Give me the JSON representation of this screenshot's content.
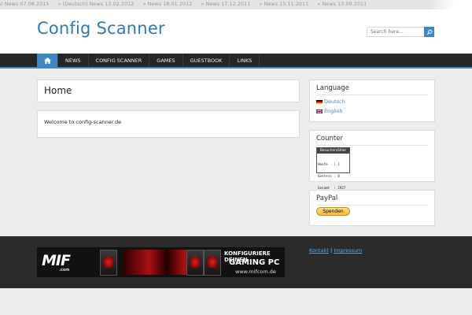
{
  "ticker": {
    "items": [
      "sch) News 07.08.2015",
      "» (Deutsch) News 13.02.2012",
      "» News 18.01.2012",
      "» News 17.12.2011",
      "» News 15.11.2011",
      "» News 13.09.2011"
    ]
  },
  "header": {
    "title": "Config Scanner",
    "search_placeholder": "Search here...",
    "search_icon": "search-icon"
  },
  "nav": {
    "home_icon": "home-icon",
    "items": [
      "NEWS",
      "CONFIG SCANNER",
      "GAMES",
      "GUESTBOOK",
      "LINKS"
    ]
  },
  "main": {
    "page_title": "Home",
    "welcome_text": "Welcome to config-scanner.de"
  },
  "sidebar": {
    "language": {
      "title": "Language",
      "items": [
        "Deutsch",
        "English"
      ]
    },
    "counter": {
      "title": "Counter",
      "widget_title": "Besucherzähler",
      "lines": [
        "Heute   : 1",
        "Gestern : 0",
        "Gesamt  : 2927",
        "Online  : 1"
      ]
    },
    "paypal": {
      "title": "PayPal",
      "button_label": "Spenden"
    }
  },
  "footer": {
    "banner": {
      "logo": "MIF",
      "logo_sub": ".com",
      "line1": "KONFIGURIERE DEINEN",
      "line2": "GAMING PC",
      "line3": "www.mifcom.de"
    },
    "links": [
      "Kontakt",
      "Impressum"
    ],
    "separator": "|"
  },
  "colors": {
    "accent": "#3f86c7",
    "title": "#2f7ab3",
    "nav_bg": "#262626",
    "footer_bg": "#2b2b2b",
    "page_bg": "#ececec"
  }
}
